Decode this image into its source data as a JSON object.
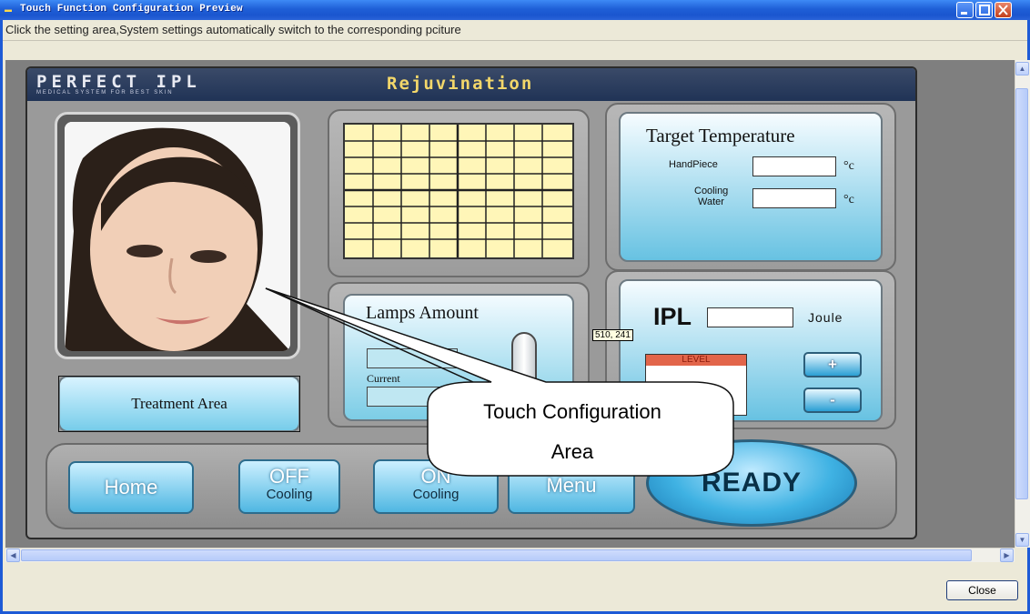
{
  "window": {
    "title": "Touch Function Configuration Preview",
    "minimize_icon": "minimize-icon",
    "maximize_icon": "maximize-icon",
    "close_icon": "close-icon"
  },
  "hint": "Click the setting area,System settings automatically switch to the corresponding pciture",
  "device": {
    "brand": "PERFECT IPL",
    "brand_sub": "MEDICAL SYSTEM FOR BEST SKIN",
    "mode": "Rejuvination",
    "target_temperature": {
      "title": "Target Temperature",
      "handpiece_label": "HandPiece",
      "cooling_label_1": "Cooling",
      "cooling_label_2": "Water",
      "unit": "°c"
    },
    "lamps": {
      "title": "Lamps Amount",
      "current_label": "Current"
    },
    "ipl": {
      "label": "IPL",
      "unit": "Joule",
      "level_label": "LEVEL",
      "plus": "+",
      "minus": "-"
    },
    "treatment_area": "Treatment Area",
    "buttons": {
      "home": "Home",
      "off_cooling_top": "OFF",
      "off_cooling_sub": "Cooling",
      "on_cooling_top": "ON",
      "on_cooling_sub": "Cooling",
      "menu": "Menu",
      "ready": "READY"
    }
  },
  "callout": {
    "line1": "Touch Configuration",
    "line2": "Area"
  },
  "tooltip": "510, 241",
  "footer": {
    "close": "Close"
  }
}
